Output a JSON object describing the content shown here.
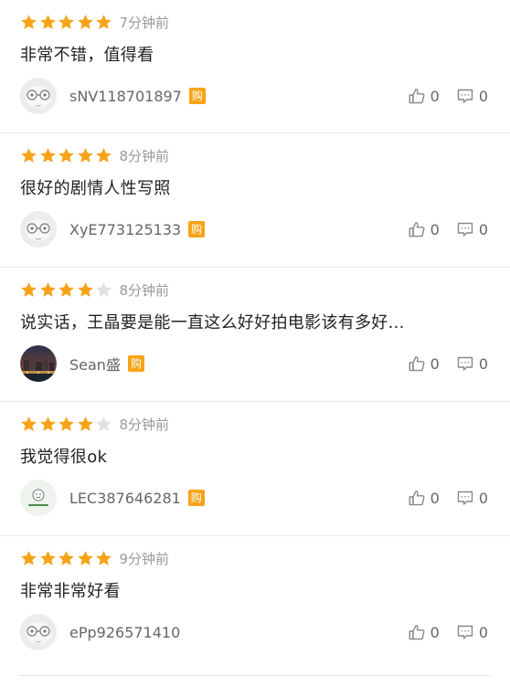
{
  "accent_color": "#f7a318",
  "empty_star_color": "#e0e0e0",
  "reviews": [
    {
      "rating": 5,
      "time": "7分钟前",
      "text": "非常不错，值得看",
      "username": "sNV118701897",
      "badge": "购",
      "avatar": "glasses-avatar",
      "likes": "0",
      "comments": "0"
    },
    {
      "rating": 5,
      "time": "8分钟前",
      "text": "很好的剧情人性写照",
      "username": "XyE773125133",
      "badge": "购",
      "avatar": "glasses-avatar",
      "likes": "0",
      "comments": "0"
    },
    {
      "rating": 4,
      "time": "8分钟前",
      "text": "说实话，王晶要是能一直这么好好拍电影该有多好...",
      "username": "Sean盛",
      "badge": "购",
      "avatar": "city-night-avatar",
      "likes": "0",
      "comments": "0"
    },
    {
      "rating": 4,
      "time": "8分钟前",
      "text": "我觉得很ok",
      "username": "LEC387646281",
      "badge": "购",
      "avatar": "green-logo-avatar",
      "likes": "0",
      "comments": "0"
    },
    {
      "rating": 5,
      "time": "9分钟前",
      "text": "非常非常好看",
      "username": "ePp926571410",
      "badge": "",
      "avatar": "glasses-avatar",
      "likes": "0",
      "comments": "0"
    }
  ]
}
